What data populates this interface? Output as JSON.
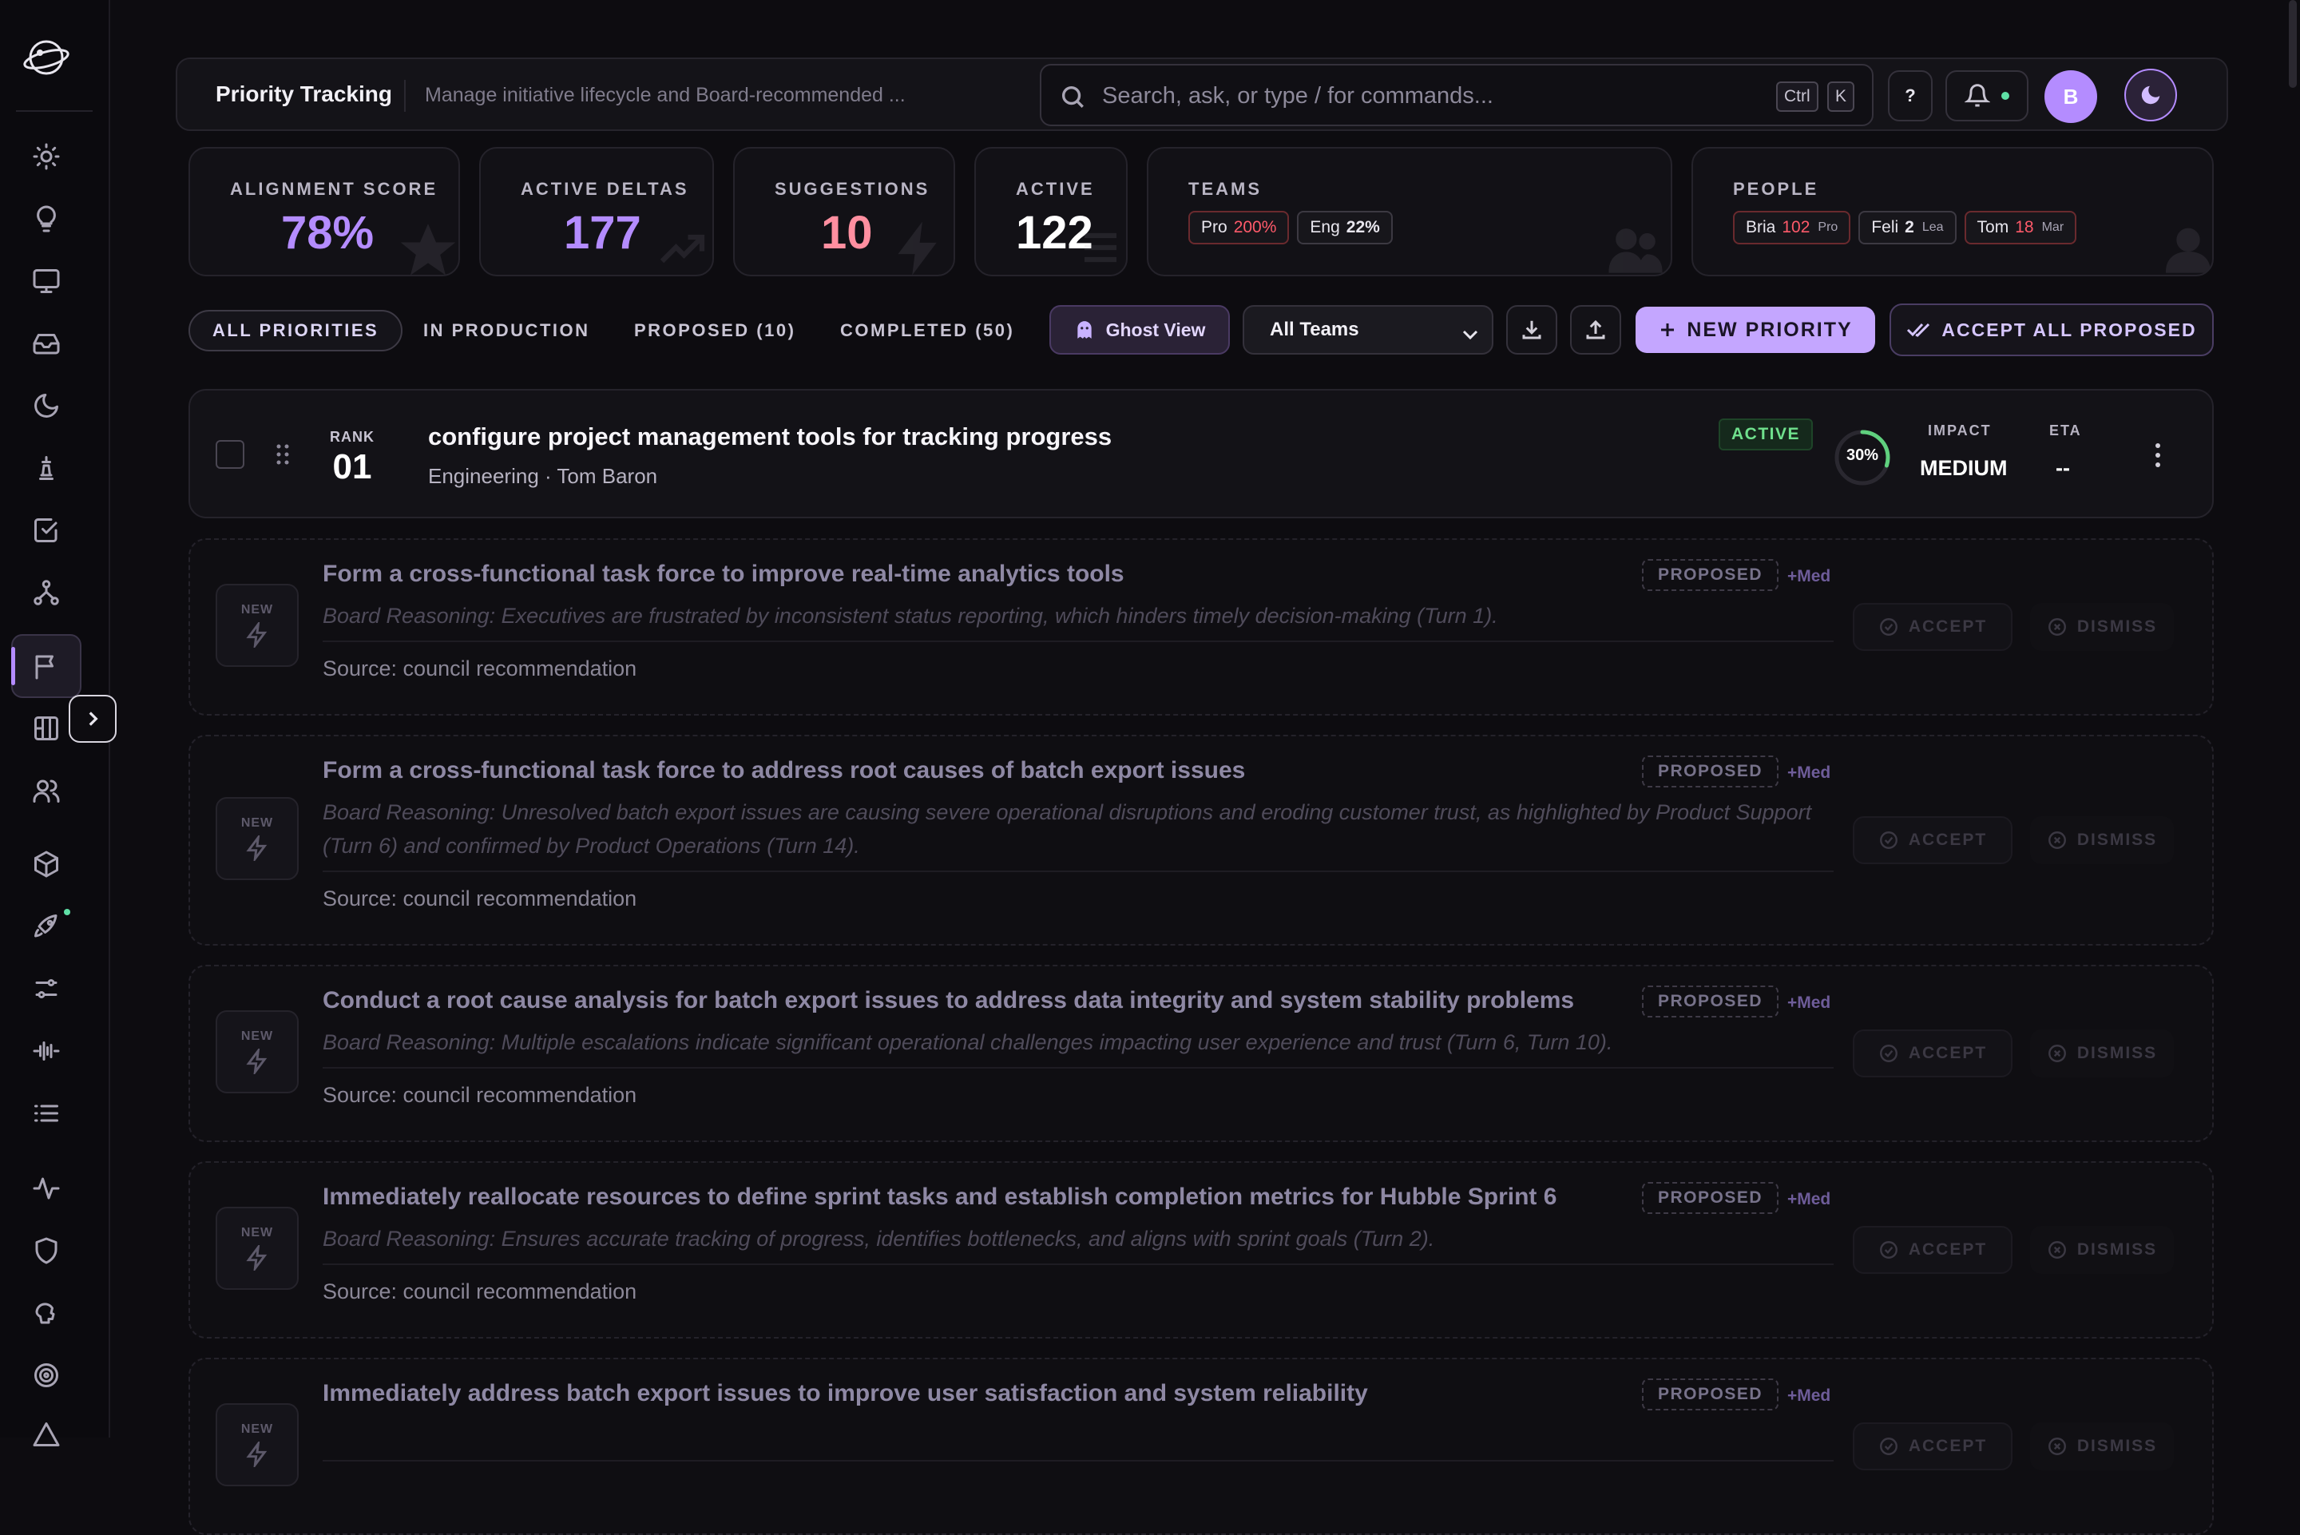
{
  "header": {
    "title": "Priority Tracking",
    "subtitle": "Manage initiative lifecycle and Board-recommended ...",
    "search_placeholder": "Search, ask, or type / for commands...",
    "kbd_ctrl": "Ctrl",
    "kbd_k": "K",
    "help_label": "?",
    "avatar_initial": "B"
  },
  "stats": {
    "alignment": {
      "label": "ALIGNMENT SCORE",
      "value": "78%",
      "color": "#b48cff"
    },
    "deltas": {
      "label": "ACTIVE DELTAS",
      "value": "177",
      "color": "#b48cff"
    },
    "suggestions": {
      "label": "SUGGESTIONS",
      "value": "10",
      "color": "#ff8fa0"
    },
    "active": {
      "label": "ACTIVE",
      "value": "122",
      "color": "#ffffff"
    },
    "teams": {
      "label": "TEAMS",
      "items": [
        {
          "name": "Pro",
          "value": "200%"
        },
        {
          "name": "Eng",
          "value": "22%"
        }
      ]
    },
    "people": {
      "label": "PEOPLE",
      "items": [
        {
          "name": "Bria",
          "value": "102",
          "tag": "Pro"
        },
        {
          "name": "Feli",
          "value": "2",
          "tag": "Lea"
        },
        {
          "name": "Tom",
          "value": "18",
          "tag": "Mar"
        }
      ]
    }
  },
  "tabs": {
    "all": "ALL PRIORITIES",
    "production": "IN PRODUCTION",
    "proposed": "PROPOSED (10)",
    "completed": "COMPLETED (50)"
  },
  "toolbar": {
    "ghost_view": "Ghost View",
    "team_filter": "All Teams",
    "new_priority": "NEW PRIORITY",
    "accept_all": "ACCEPT ALL PROPOSED"
  },
  "active_item": {
    "rank_label": "RANK",
    "rank": "01",
    "title": "configure project management tools for tracking progress",
    "meta": "Engineering · Tom Baron",
    "status": "ACTIVE",
    "progress": "30%",
    "progress_fraction": 0.3,
    "impact_label": "IMPACT",
    "impact": "MEDIUM",
    "eta_label": "ETA",
    "eta": "--"
  },
  "proposed_common": {
    "new_label": "NEW",
    "badge": "PROPOSED",
    "impact": "+Med",
    "accept": "ACCEPT",
    "dismiss": "DISMISS"
  },
  "proposals": [
    {
      "title": "Form a cross-functional task force to improve real-time analytics tools",
      "reasoning": "Board Reasoning: Executives are frustrated by inconsistent status reporting, which hinders timely decision-making (Turn 1).",
      "source": "Source: council recommendation"
    },
    {
      "title": "Form a cross-functional task force to address root causes of batch export issues",
      "reasoning": "Board Reasoning: Unresolved batch export issues are causing severe operational disruptions and eroding customer trust, as highlighted by Product Support (Turn 6) and confirmed by Product Operations (Turn 14).",
      "source": "Source: council recommendation"
    },
    {
      "title": "Conduct a root cause analysis for batch export issues to address data integrity and system stability problems",
      "reasoning": "Board Reasoning: Multiple escalations indicate significant operational challenges impacting user experience and trust (Turn 6, Turn 10).",
      "source": "Source: council recommendation"
    },
    {
      "title": "Immediately reallocate resources to define sprint tasks and establish completion metrics for Hubble Sprint 6",
      "reasoning": "Board Reasoning: Ensures accurate tracking of progress, identifies bottlenecks, and aligns with sprint goals (Turn 2).",
      "source": "Source: council recommendation"
    },
    {
      "title": "Immediately address batch export issues to improve user satisfaction and system reliability",
      "reasoning": "",
      "source": ""
    }
  ],
  "colors": {
    "accent": "#b48cff",
    "active_green": "#6fe08d",
    "danger_red": "#ff5a6a"
  },
  "icons": {
    "sidebar": [
      "sun-icon",
      "lightbulb-icon",
      "monitor-icon",
      "inbox-icon",
      "moon-icon",
      "chess-piece-icon",
      "checklist-icon",
      "network-icon",
      "flag-icon",
      "board-icon",
      "users-icon",
      "cube-icon",
      "rocket-icon",
      "sliders-icon",
      "waveform-icon",
      "list-icon",
      "activity-icon",
      "shield-icon",
      "brain-icon",
      "target-icon",
      "triangle-icon"
    ]
  }
}
